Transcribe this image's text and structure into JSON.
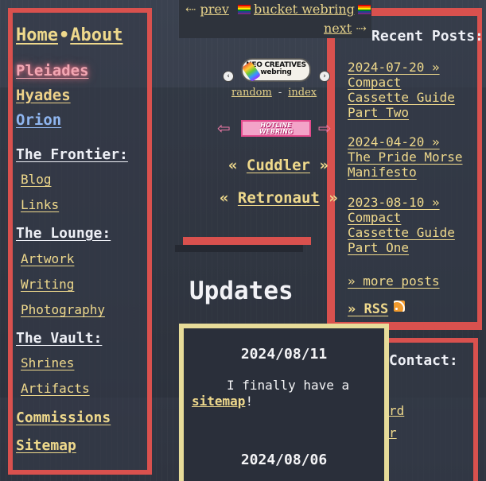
{
  "sidebar": {
    "home": "Home",
    "separator": "•",
    "about": "About",
    "stars": [
      "Pleiades",
      "Hyades",
      "Orion"
    ],
    "frontier": {
      "heading": "The Frontier:",
      "links": [
        "Blog",
        "Links"
      ]
    },
    "lounge": {
      "heading": "The Lounge:",
      "links": [
        "Artwork",
        "Writing",
        "Photography"
      ]
    },
    "vault": {
      "heading": "The Vault:",
      "links": [
        "Shrines",
        "Artifacts"
      ]
    },
    "commissions": "Commissions",
    "sitemap": "Sitemap"
  },
  "webrings": {
    "bucket": {
      "prev_arrow": "⇠",
      "prev": "prev",
      "name": "bucket webring",
      "next": "next",
      "next_arrow": "⇢"
    },
    "neo": {
      "badge_text": "NEO CREATIVES webring",
      "left_arrow": "‹",
      "right_arrow": "›",
      "random": "random",
      "separator": "-",
      "index": "index"
    },
    "hotline": {
      "badge_text": "HOTLINE WEBRING",
      "left_arrow": "⇦",
      "right_arrow": "⇨"
    },
    "cuddler": {
      "left": "«",
      "name": "Cuddler",
      "right": "»"
    },
    "retronaut": {
      "left": "«",
      "name": "Retronaut",
      "right": "»"
    }
  },
  "updates": {
    "title": "Updates",
    "entries": [
      {
        "date": "2024/08/11",
        "text_before": "I finally have a ",
        "link": "sitemap",
        "text_after": "!"
      },
      {
        "date": "2024/08/06"
      }
    ]
  },
  "recent": {
    "title": "Recent Posts:",
    "posts": [
      {
        "date": "2024-07-20 »",
        "title": "Compact Cassette Guide Part Two"
      },
      {
        "date": "2024-04-20 »",
        "title": "The Pride Morse Manifesto"
      },
      {
        "date": "2023-08-10 »",
        "title": "Compact Cassette Guide Part One"
      }
    ],
    "more": "» more posts",
    "rss": "» RSS",
    "rss_icon": "rss-feed-icon"
  },
  "contact": {
    "title": "Contact:",
    "links": [
      "rd",
      "r"
    ]
  },
  "colors": {
    "accent_red": "#d9514e",
    "link_gold": "#efd98c",
    "updates_border": "#e7dc99",
    "background": "#363c48"
  }
}
